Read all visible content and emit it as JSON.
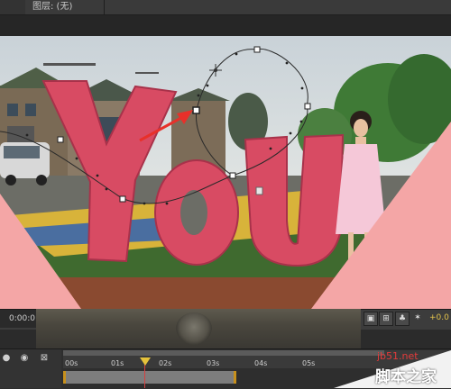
{
  "panel": {
    "tab_label": "图层: (无)"
  },
  "timecode": "0:00:0",
  "status_number": "+0.0",
  "ruler": {
    "ticks": [
      "00s",
      "01s",
      "02s",
      "03s",
      "04s",
      "05s"
    ]
  },
  "sign_letters": "YOU",
  "watermark": {
    "url": "jb51.net",
    "name": "脚本之家"
  },
  "colors": {
    "letters": "#d84b63",
    "pink_overlay": "#f4a6a6",
    "arrow": "#e8302a",
    "cti": "#e5c23b",
    "work_area_edge": "#c7901c"
  },
  "icons": [
    "motion-path-handle-icon",
    "pen-cursor-icon",
    "eye-icon",
    "graph-icon",
    "flowchart-icon",
    "motion-blur-icon"
  ]
}
